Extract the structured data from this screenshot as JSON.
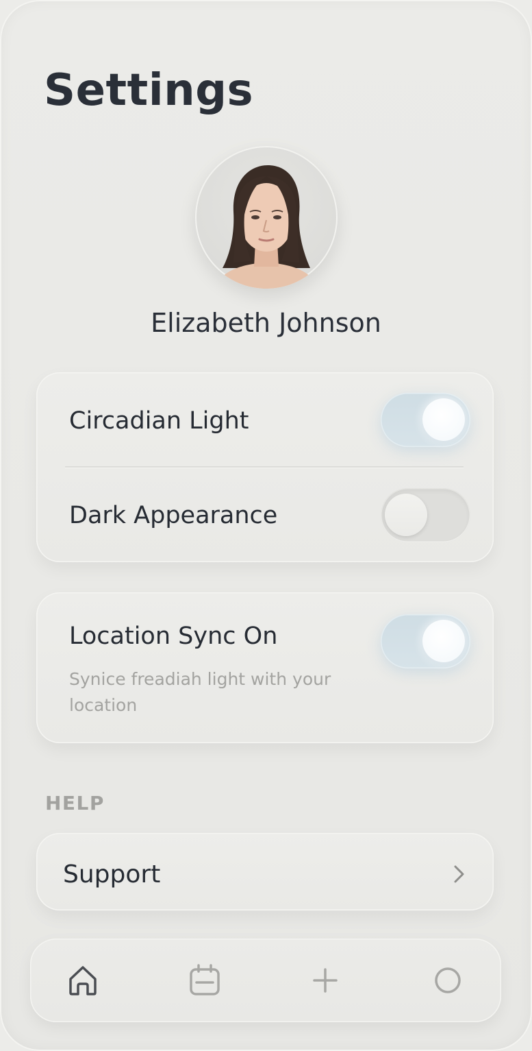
{
  "header": {
    "title": "Settings"
  },
  "profile": {
    "name": "Elizabeth Johnson",
    "avatar_icon": "user-portrait"
  },
  "display_settings": {
    "items": [
      {
        "label": "Circadian Light",
        "enabled": true
      },
      {
        "label": "Dark Appearance",
        "enabled": false
      }
    ]
  },
  "location": {
    "label": "Location Sync On",
    "description": "Synice freadiah light with your location",
    "enabled": true
  },
  "help": {
    "section_title": "HELP",
    "items": [
      {
        "label": "Support",
        "icon": "chevron-right-icon"
      }
    ]
  },
  "tab_bar": {
    "items": [
      {
        "icon": "home-icon",
        "active": true
      },
      {
        "icon": "calendar-icon",
        "active": false
      },
      {
        "icon": "plus-icon",
        "active": false
      },
      {
        "icon": "circle-icon",
        "active": false
      }
    ]
  },
  "colors": {
    "background": "#ebebe8",
    "text_primary": "#262b33",
    "text_secondary": "#a3a3a0",
    "toggle_on": "#d2dfe6",
    "toggle_off": "#dededb"
  }
}
